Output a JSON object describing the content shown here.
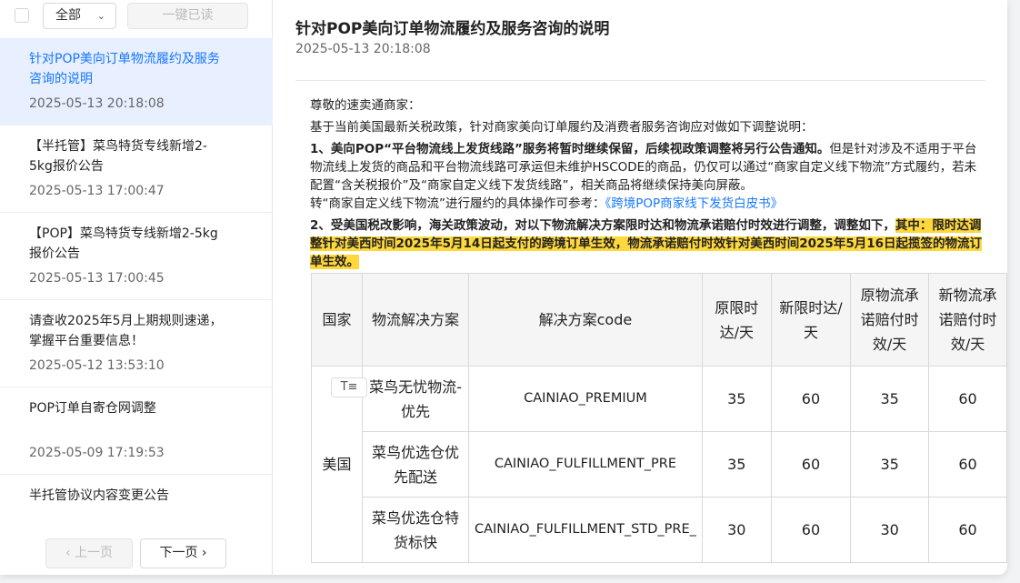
{
  "toolbar": {
    "filter_value": "全部",
    "read_all_label": "一键已读"
  },
  "list": [
    {
      "title": "针对POP美向订单物流履约及服务咨询的说明",
      "date": "2025-05-13 20:18:08",
      "active": true
    },
    {
      "title": "【半托管】菜鸟特货专线新增2-5kg报价公告",
      "date": "2025-05-13 17:00:47"
    },
    {
      "title": "【POP】菜鸟特货专线新增2-5kg报价公告",
      "date": "2025-05-13 17:00:45"
    },
    {
      "title": "请查收2025年5月上期规则速递，掌握平台重要信息！",
      "date": "2025-05-12 13:53:10"
    },
    {
      "title": "POP订单自寄仓网调整",
      "date": "2025-05-09 17:19:53"
    },
    {
      "title": "半托管协议内容变更公告",
      "date": ""
    }
  ],
  "pager": {
    "prev_label": "上一页",
    "next_label": "下一页"
  },
  "article": {
    "title": "针对POP美向订单物流履约及服务咨询的说明",
    "date": "2025-05-13 20:18:08",
    "greeting": "尊敬的速卖通商家：",
    "intro": "基于当前美国最新关税政策，针对商家美向订单履约及消费者服务咨询应对做如下调整说明：",
    "p1_bold": "1、美向POP“平台物流线上发货线路”服务将暂时继续保留，后续视政策调整将另行公告通知。",
    "p1_rest": "但是针对涉及不适用于平台物流线上发货的商品和平台物流线路可承运但未维护HSCODE的商品，仍仅可以通过“商家自定义线下物流”方式履约，若未配置“含关税报价”及“商家自定义线下发货线路”，相关商品将继续保持美向屏蔽。",
    "p1_ref_prefix": "转“商家自定义线下物流”进行履约的具体操作可参考：",
    "p1_ref_link": "《跨境POP商家线下发货白皮书》",
    "p2_bold": "2、受美国税改影响，海关政策波动，对以下物流解决方案限时达和物流承诺赔付时效进行调整，调整如下，",
    "p2_highlight": "其中：限时达调整针对美西时间2025年5月14日起支付的跨境订单生效，物流承诺赔付时效针对美西时间2025年5月16日起揽签的物流订单生效。"
  },
  "table": {
    "headers": [
      "国家",
      "物流解决方案",
      "解决方案code",
      "原限时达/天",
      "新限时达/天",
      "原物流承诺赔付时效/天",
      "新物流承诺赔付时效/天"
    ],
    "country": "美国",
    "rows": [
      [
        "菜鸟无忧物流-优先",
        "CAINIAO_PREMIUM",
        "35",
        "60",
        "35",
        "60"
      ],
      [
        "菜鸟优选仓优先配送",
        "CAINIAO_FULFILLMENT_PRE",
        "35",
        "60",
        "35",
        "60"
      ],
      [
        "菜鸟优选仓特货标快",
        "CAINIAO_FULFILLMENT_STD_PRE_",
        "30",
        "60",
        "30",
        "60"
      ]
    ]
  }
}
